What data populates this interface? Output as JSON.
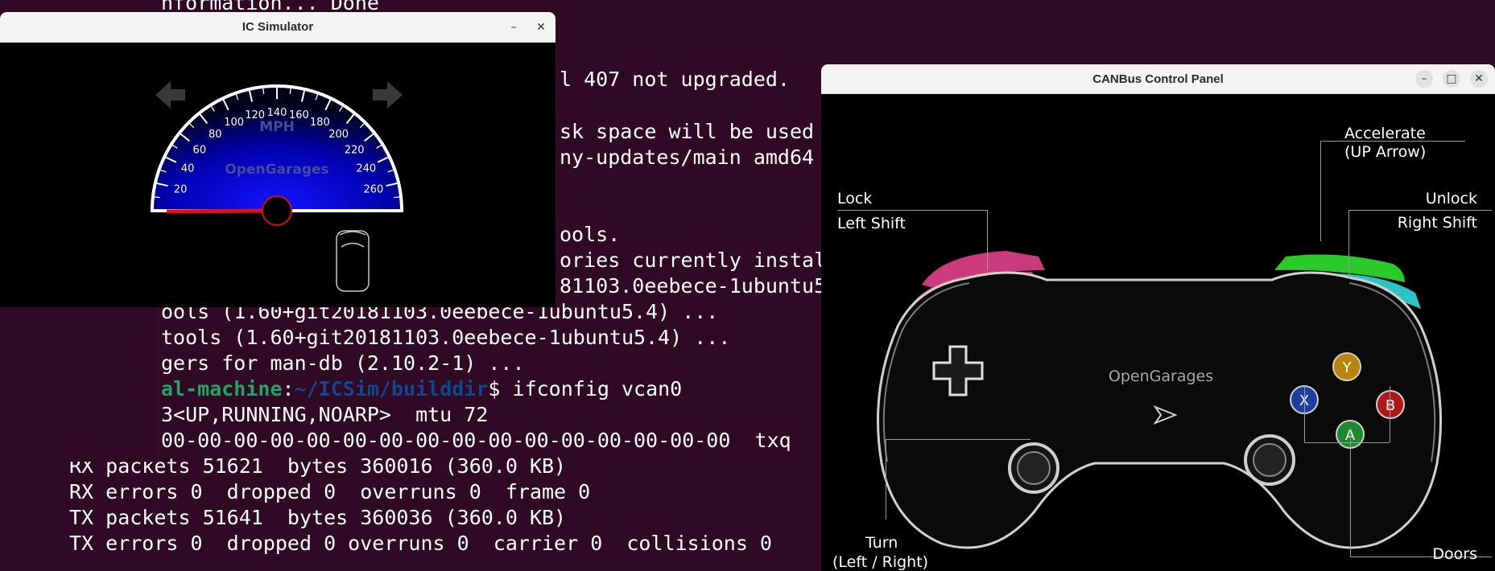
{
  "terminal": {
    "lines": [
      "nformation... Done",
      "l 407 not upgraded.",
      "sk space will be used",
      "ny-updates/main amd64",
      "ools.",
      "ories currently instal",
      "81103.0eebece-1ubuntu5",
      "ools (1.60+git20181103.0eebece-1ubuntu5.4) ...",
      "tools (1.60+git20181103.0eebece-1ubuntu5.4) ...",
      "gers for man-db (2.10.2-1) ...",
      "3<UP,RUNNING,NOARP>  mtu 72",
      "00-00-00-00-00-00-00-00-00-00-00-00-00-00-00-00  txq",
      "RX packets 51621  bytes 360016 (360.0 KB)",
      "RX errors 0  dropped 0  overruns 0  frame 0",
      "TX packets 51641  bytes 360036 (360.0 KB)",
      "TX errors 0  dropped 0 overruns 0  carrier 0  collisions 0"
    ],
    "prompt": {
      "user": "al-machine",
      "sep": ":",
      "path": "~/ICSim/builddir",
      "symbol": "$ ",
      "command": "ifconfig vcan0"
    }
  },
  "ic_window": {
    "title": "IC Simulator",
    "minimize": "–",
    "close": "✕",
    "speedo": {
      "unit": "MPH",
      "brand": "OpenGarages",
      "ticks": [
        "20",
        "40",
        "60",
        "80",
        "100",
        "120",
        "140",
        "160",
        "180",
        "200",
        "220",
        "240",
        "260"
      ],
      "speed": 0,
      "max_speed": 280
    },
    "left_arrow_icon": "arrow-left-icon",
    "right_arrow_icon": "arrow-right-icon",
    "car_icon": "car-doors-icon"
  },
  "can_window": {
    "title": "CANBus Control Panel",
    "minimize": "–",
    "maximize": "□",
    "close": "✕",
    "brand": "OpenGarages",
    "labels": {
      "accelerate": "Accelerate",
      "accelerate_key": "(UP Arrow)",
      "lock": "Lock",
      "lock_key": "Left Shift",
      "unlock": "Unlock",
      "unlock_key": "Right Shift",
      "turn": "Turn",
      "turn_key": "(Left / Right)",
      "doors": "Doors"
    },
    "buttons": {
      "y": "Y",
      "x": "X",
      "b": "B",
      "a": "A"
    },
    "colors": {
      "y": "#b8860b",
      "x": "#1f3fa0",
      "b": "#b01818",
      "a": "#1c8a2c",
      "lock_pink": "#e0408a",
      "lock_red": "#e04848",
      "accel_green": "#2ee02e",
      "unlock_cyan": "#30d8d8"
    }
  }
}
